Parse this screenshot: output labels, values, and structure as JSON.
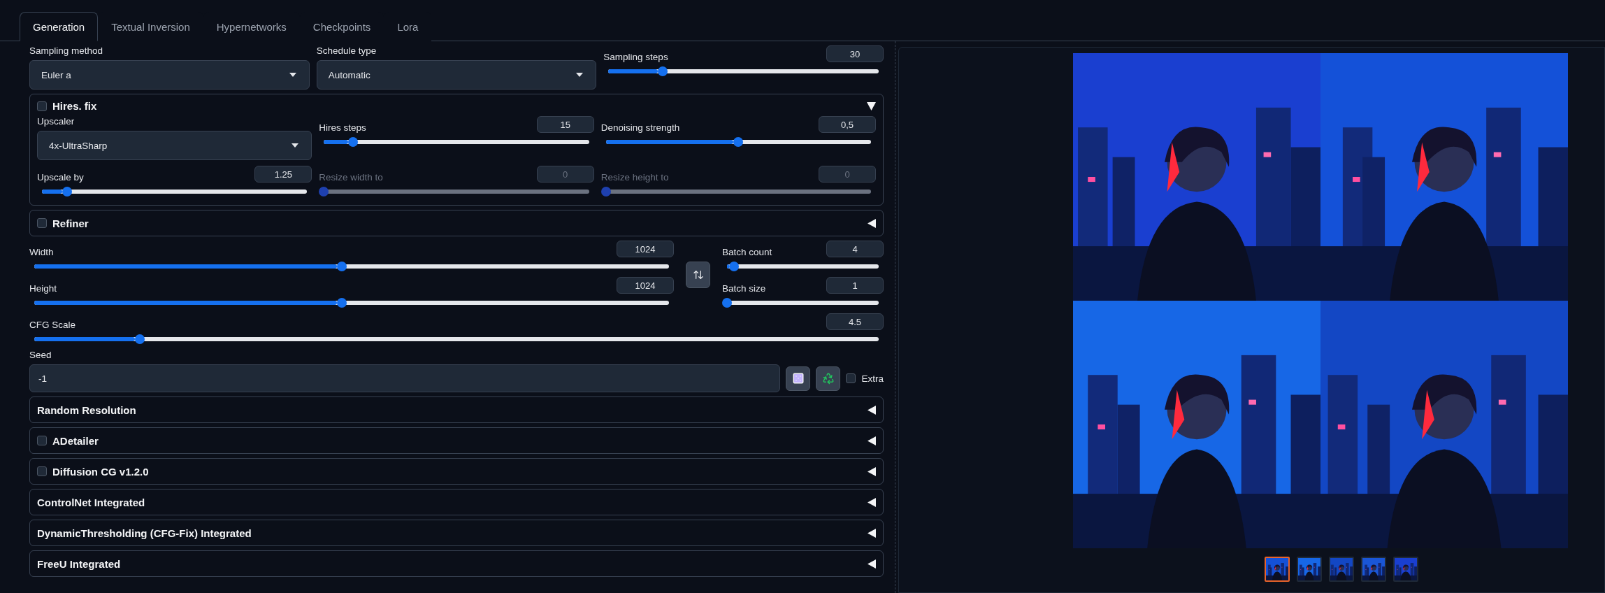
{
  "tabs": [
    {
      "label": "Generation",
      "selected": true
    },
    {
      "label": "Textual Inversion",
      "selected": false
    },
    {
      "label": "Hypernetworks",
      "selected": false
    },
    {
      "label": "Checkpoints",
      "selected": false
    },
    {
      "label": "Lora",
      "selected": false
    }
  ],
  "sampling": {
    "method": {
      "label": "Sampling method",
      "value": "Euler a"
    },
    "schedule": {
      "label": "Schedule type",
      "value": "Automatic"
    },
    "steps": {
      "label": "Sampling steps",
      "value": "30",
      "level": 0.2,
      "disabled": false
    }
  },
  "hires_fix": {
    "title": "Hires. fix",
    "checked": false,
    "expanded": true,
    "items": [
      {
        "kind": "dropdown",
        "label": "Upscaler",
        "value": "4x-UltraSharp"
      },
      {
        "kind": "slider",
        "label": "Hires steps",
        "value": "15",
        "level": 0.11,
        "disabled": false
      },
      {
        "kind": "slider",
        "label": "Denoising strength",
        "value": "0,5",
        "level": 0.5,
        "disabled": false
      },
      {
        "kind": "slider",
        "label": "Upscale by",
        "value": "1.25",
        "level": 0.095,
        "disabled": false
      },
      {
        "kind": "slider",
        "label": "Resize width to",
        "value": "0",
        "level": 0,
        "disabled": true
      },
      {
        "kind": "slider",
        "label": "Resize height to",
        "value": "0",
        "level": 0,
        "disabled": true
      }
    ]
  },
  "refiner": {
    "title": "Refiner",
    "checked": false,
    "expanded": false
  },
  "dimensions": {
    "width": {
      "label": "Width",
      "value": "1024",
      "level": 0.485,
      "disabled": false
    },
    "height": {
      "label": "Height",
      "value": "1024",
      "level": 0.485,
      "disabled": false
    },
    "batch_count": {
      "label": "Batch count",
      "value": "4",
      "level": 0.045,
      "disabled": false
    },
    "batch_size": {
      "label": "Batch size",
      "value": "1",
      "level": 0,
      "disabled": false
    }
  },
  "cfg_scale": {
    "label": "CFG Scale",
    "value": "4.5",
    "level": 0.125,
    "disabled": false
  },
  "seed": {
    "label": "Seed",
    "value": "-1",
    "extra": {
      "label": "Extra",
      "checked": false
    }
  },
  "accordions": [
    {
      "kind": "plain",
      "title": "Random Resolution",
      "expanded": false
    },
    {
      "kind": "checkbox",
      "title": "ADetailer",
      "checked": false,
      "expanded": false
    },
    {
      "kind": "checkbox",
      "title": "Diffusion CG v1.2.0",
      "checked": false,
      "expanded": false
    },
    {
      "kind": "plain",
      "title": "ControlNet Integrated",
      "expanded": false
    },
    {
      "kind": "plain",
      "title": "DynamicThresholding (CFG-Fix) Integrated",
      "expanded": false
    },
    {
      "kind": "plain",
      "title": "FreeU Integrated",
      "expanded": false
    }
  ],
  "gallery": {
    "images": [
      {
        "kind": "picture"
      },
      {
        "kind": "picture"
      },
      {
        "kind": "picture"
      },
      {
        "kind": "picture"
      }
    ],
    "thumbnails": [
      {
        "kind": "picture",
        "selected": true
      },
      {
        "kind": "picture",
        "selected": false
      },
      {
        "kind": "picture",
        "selected": false
      },
      {
        "kind": "picture",
        "selected": false
      },
      {
        "kind": "picture",
        "selected": false
      }
    ]
  }
}
